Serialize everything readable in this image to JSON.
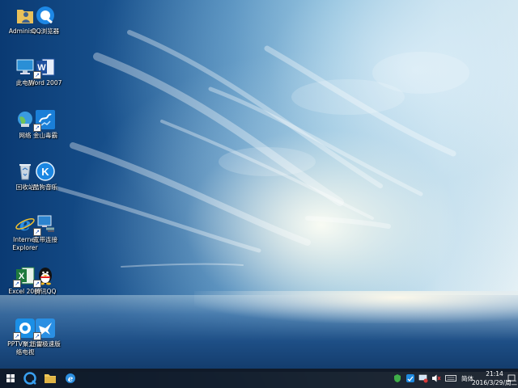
{
  "desktop_icons": {
    "administrator": "Administ…",
    "qq_browser": "QQ浏览器",
    "this_pc": "此电脑",
    "word": "Word 2007",
    "network": "网络",
    "kingsoft_av": "金山毒霸",
    "recycle_bin": "回收站",
    "kugou": "酷狗音乐",
    "ie_line1": "Internet",
    "ie_line2": "Explorer",
    "broadband": "宽带连接",
    "excel": "Excel 2007",
    "tencent_qq": "腾讯QQ",
    "pptv_line1": "PPTV聚力 网",
    "pptv_line2": "络电视",
    "xunlei": "迅雷极速版"
  },
  "taskbar": {
    "ime_label": "简体",
    "clock_time": "21:14",
    "clock_date": "2016/3/29/周二"
  },
  "icons": {
    "start": "windows-logo-icon",
    "search": "qq-browser-taskbar-icon",
    "explorer": "folder-icon",
    "ie": "internet-explorer-icon"
  }
}
